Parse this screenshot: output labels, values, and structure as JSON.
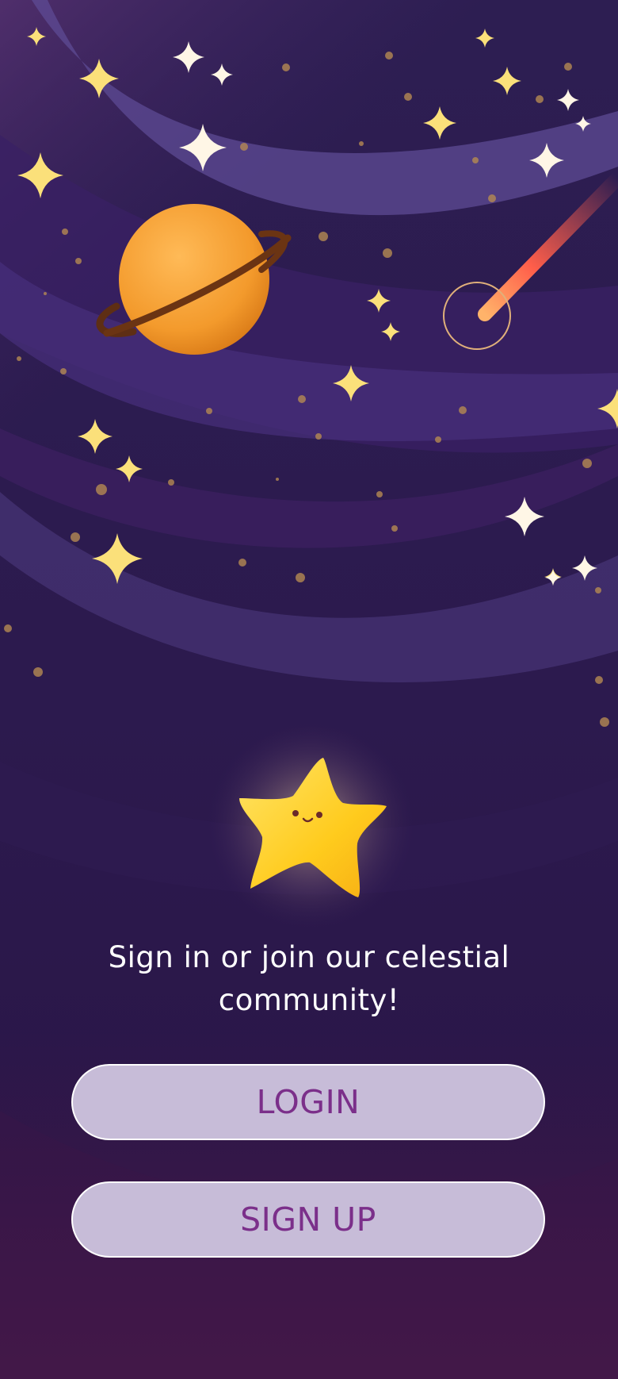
{
  "welcome": {
    "tagline": "Sign in or join our celestial community!"
  },
  "actions": {
    "login_label": "LOGIN",
    "signup_label": "SIGN UP"
  },
  "theme": {
    "background": "#2b1748",
    "button_fill": "#c7bcd8",
    "button_text": "#7b2f8a",
    "planet": "#f39a2c",
    "star": "#ffcc1f"
  },
  "icons": [
    "planet-icon",
    "comet-icon",
    "star-mascot-icon",
    "sparkle-icon"
  ]
}
